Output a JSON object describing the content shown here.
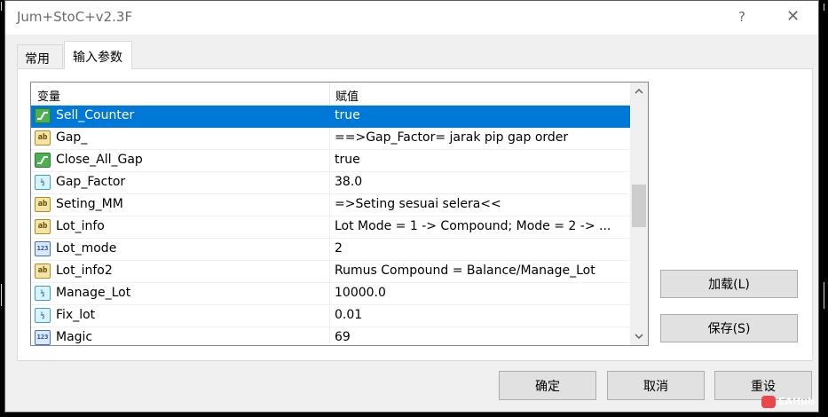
{
  "window": {
    "title": "Jum+StoC+v2.3F",
    "help_label": "?",
    "close_label": "✕"
  },
  "tabs": [
    {
      "label": "常用",
      "active": false
    },
    {
      "label": "输入参数",
      "active": true
    }
  ],
  "grid": {
    "headers": {
      "name": "变量",
      "value": "赋值"
    },
    "rows": [
      {
        "icon": "bool-icon",
        "name": "Sell_Counter",
        "value": "true",
        "selected": true
      },
      {
        "icon": "string-icon",
        "name": "Gap_",
        "value": "==>Gap_Factor= jarak pip gap order"
      },
      {
        "icon": "bool-icon",
        "name": "Close_All_Gap",
        "value": "true"
      },
      {
        "icon": "double-icon",
        "name": "Gap_Factor",
        "value": "38.0"
      },
      {
        "icon": "string-icon",
        "name": "Seting_MM",
        "value": "=>Seting sesuai selera<<"
      },
      {
        "icon": "string-icon",
        "name": "Lot_info",
        "value": "Lot Mode = 1 -> Compound; Mode = 2 -> ..."
      },
      {
        "icon": "integer-icon",
        "name": "Lot_mode",
        "value": "2"
      },
      {
        "icon": "string-icon",
        "name": "Lot_info2",
        "value": "Rumus Compound = Balance/Manage_Lot"
      },
      {
        "icon": "double-icon",
        "name": "Manage_Lot",
        "value": "10000.0"
      },
      {
        "icon": "double-icon",
        "name": "Fix_lot",
        "value": "0.01"
      },
      {
        "icon": "integer-icon",
        "name": "Magic",
        "value": "69"
      }
    ],
    "icon_text": {
      "string": "ab",
      "double": "½",
      "integer": "123"
    }
  },
  "buttons": {
    "load": "加载(L)",
    "save": "保存(S)",
    "ok": "确定",
    "cancel": "取消",
    "reset": "重设"
  },
  "watermark": "EAHub",
  "colors": {
    "selection": "#0078d7",
    "dialog_bg": "#f0f0f0",
    "button_bg": "#e1e1e1"
  }
}
